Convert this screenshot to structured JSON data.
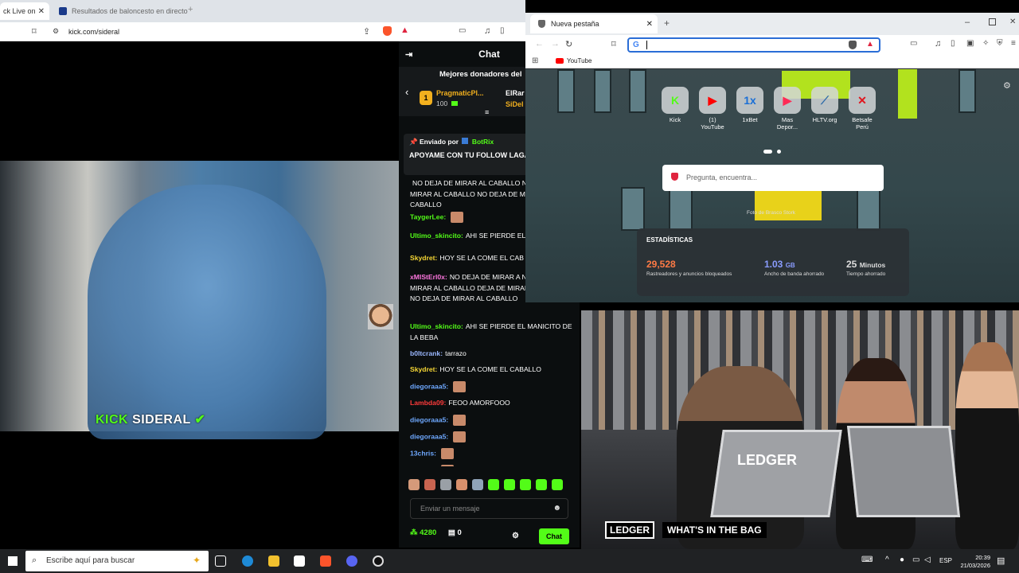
{
  "left_browser": {
    "tabs": [
      {
        "label": "ck Live on"
      },
      {
        "label": "Resultados de baloncesto en directo"
      }
    ],
    "address": "kick.com/sideral",
    "stream_overlay": {
      "brand": "KICK",
      "channel": "SIDERAL"
    }
  },
  "chat": {
    "title": "Chat",
    "top_donors_title": "Mejores donadores del",
    "donors": [
      {
        "rank": "1",
        "name": "PragmaticPl...",
        "amount": "100"
      },
      {
        "rank": "",
        "name": "ElRar",
        "amount": ""
      },
      {
        "rank": "",
        "name": "SiDel",
        "amount": ""
      }
    ],
    "pinned": {
      "by_label": "Enviado por",
      "by_user": "BotRix",
      "text": "APOYAME CON TU FOLLOW LAGARTIJA ..."
    },
    "messages": [
      {
        "user": "",
        "text": "NO DEJA DE MIRAR AL CABALLO NO DEJA DE MIRAR AL CABALLO NO DEJA DE MIRAR AL CABALLO",
        "color": "#ffffff"
      },
      {
        "user": "TaygerLee:",
        "text": "",
        "color": "#53fc18"
      },
      {
        "user": "Ultimo_skincito:",
        "text": "AHI SE PIERDE EL DE LA BEBA",
        "color": "#53fc18"
      },
      {
        "user": "Skydret:",
        "text": "HOY SE LA COME EL CAB",
        "color": "#f6d735"
      },
      {
        "user": "xMlStErl0x:",
        "text": "NO DEJA DE MIRAR A NO DEJA DE MIRAR AL CABALLO DEJA DE MIRAR AL CABALLO NO DEJA DE MIRAR AL CABALLO",
        "color": "#ff77e0"
      },
      {
        "user": "Ultimo_skincito:",
        "text": "AHI SE PIERDE EL MANICITO DE LA BEBA",
        "color": "#53fc18"
      },
      {
        "user": "b0ltcrank:",
        "text": "tarrazo",
        "color": "#9bb8ff"
      },
      {
        "user": "Skydret:",
        "text": "HOY SE LA COME EL CABALLO",
        "color": "#f6d735"
      },
      {
        "user": "diegoraaa5:",
        "text": "",
        "color": "#6ea8ff"
      },
      {
        "user": "Lambda09:",
        "text": "FEOO AMORFOOO",
        "color": "#ff3b3b"
      },
      {
        "user": "diegoraaa5:",
        "text": "",
        "color": "#6ea8ff"
      },
      {
        "user": "diegoraaa5:",
        "text": "",
        "color": "#6ea8ff"
      },
      {
        "user": "13chris:",
        "text": "",
        "color": "#6ea8ff"
      },
      {
        "user": "13chris:",
        "text": "",
        "color": "#6ea8ff"
      }
    ],
    "input_placeholder": "Enviar un mensaje",
    "points": "4280",
    "gift_count": "0",
    "send_label": "Chat"
  },
  "right_browser": {
    "tab_label": "Nueva pestaña",
    "bookmark": "YouTube",
    "shortcuts": [
      {
        "label": "Kick",
        "glyph": "K",
        "color": "#53fc18"
      },
      {
        "label": "(1) YouTube",
        "glyph": "▶",
        "color": "#ff0000"
      },
      {
        "label": "1xBet",
        "glyph": "1x",
        "color": "#1a6fd6"
      },
      {
        "label": "Mas Depor...",
        "glyph": "▶",
        "color": "#ff2a55"
      },
      {
        "label": "HLTV.org",
        "glyph": "⟋",
        "color": "#2b6aa8"
      },
      {
        "label": "Betsafe Perú",
        "glyph": "✕",
        "color": "#e0161e"
      }
    ],
    "search_placeholder": "Pregunta, encuentra...",
    "photo_credit": "Foto de Brasco Stork",
    "stats": {
      "title": "ESTADÍSTICAS",
      "trackers_value": "29,528",
      "trackers_label": "Rastreadores y anuncios bloqueados",
      "bandwidth_value": "1.03",
      "bandwidth_unit": "GB",
      "bandwidth_label": "Ancho de banda ahorrado",
      "time_value": "25",
      "time_unit": "Minutos",
      "time_label": "Tiempo ahorrado"
    }
  },
  "broadcast": {
    "sponsor": "LEDGER",
    "segment": "WHAT'S IN THE BAG",
    "jersey": "LEDGER"
  },
  "taskbar": {
    "search_placeholder": "Escribe aquí para buscar",
    "lang": "ESP",
    "time": "20:39",
    "date": "21/03/2026"
  }
}
